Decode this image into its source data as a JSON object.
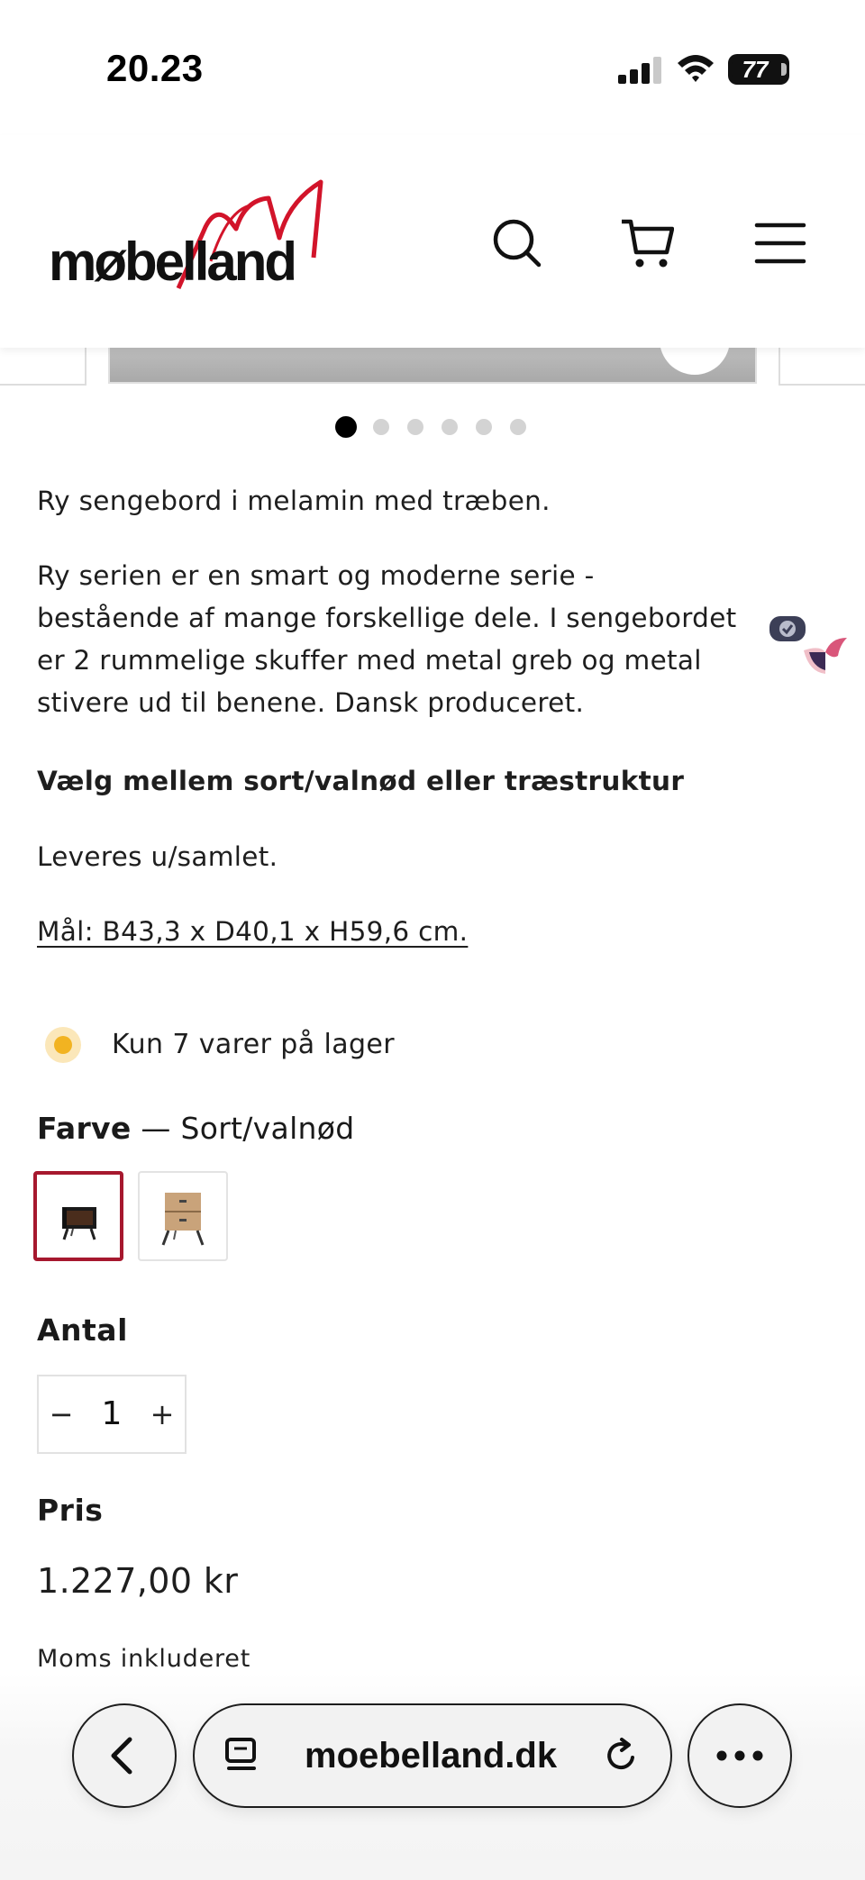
{
  "status_bar": {
    "time": "20.23",
    "battery": "77"
  },
  "header": {
    "logo_text": "møbelland",
    "brand_color": "#d2142a",
    "icons": [
      "search-icon",
      "cart-icon",
      "menu-icon"
    ]
  },
  "gallery": {
    "slide_count": 6,
    "active_index": 0
  },
  "description": {
    "intro": "Ry sengebord i melamin med træben.",
    "body_lines": [
      "Ry serien er en smart og moderne serie -",
      "bestående af mange forskellige dele. I sengebordet",
      "er 2 rummelige skuffer med metal greb og metal",
      "stivere ud til benene. Dansk produceret."
    ],
    "variant_note": "Vælg mellem sort/valnød eller træstruktur",
    "assembly": "Leveres u/samlet.",
    "dimensions": "Mål: B43,3 x D40,1 x H59,6 cm."
  },
  "stock": {
    "text": "Kun 7 varer på lager",
    "color": "#f2b321"
  },
  "color_option": {
    "label": "Farve",
    "separator": "—",
    "selected_value": "Sort/valnød",
    "selected_border_color": "#a6182e",
    "swatches": [
      "Sort/valnød",
      "Træstruktur"
    ]
  },
  "quantity": {
    "label": "Antal",
    "value": "1",
    "minus": "−",
    "plus": "+"
  },
  "price": {
    "label": "Pris",
    "value": "1.227,00 kr",
    "tax_note": "Moms inkluderet"
  },
  "browser": {
    "url": "moebelland.dk"
  }
}
